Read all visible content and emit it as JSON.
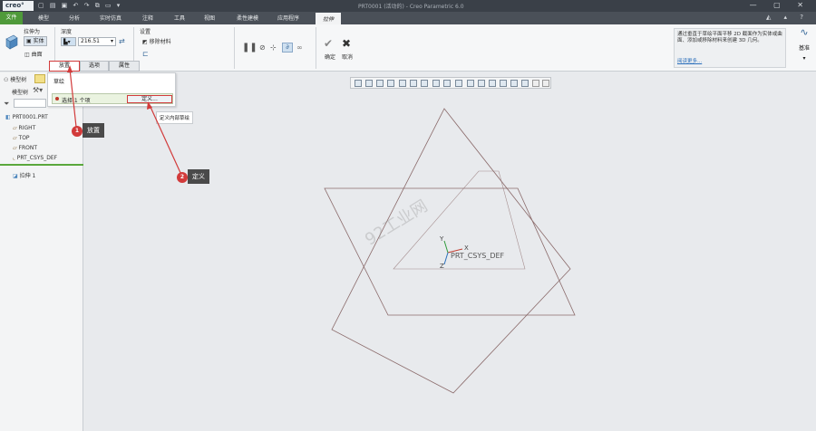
{
  "titlebar": {
    "logo": "creo°",
    "title": "PRT0001 (活动的) - Creo Parametric 6.0",
    "qat_icons": "▢ ▤ ▣ ↶ ↷ ⧉ ▭ ▾",
    "win_controls": "— ▢ ✕"
  },
  "menu": {
    "file": "文件",
    "items": [
      "模型",
      "分析",
      "实时仿真",
      "注释",
      "工具",
      "视图",
      "柔性建模",
      "应用程序"
    ],
    "active": "拉伸",
    "right_icons": "◭ ▴ ?"
  },
  "ribbon": {
    "extrude_as_label": "拉伸为",
    "solid_label": "实体",
    "surface_label": "曲面",
    "depth_label": "深度",
    "depth_value": "216.51",
    "settings_label": "设置",
    "remove_material_label": "移除材料",
    "ok_label": "确定",
    "cancel_label": "取消",
    "help_text": "通过垂直于草绘平面平移 2D 截面作为实体或曲面、添加或移除材料来创建 3D 几何。",
    "help_more": "阅读更多...",
    "base_label": "基准"
  },
  "tabs": [
    "放置",
    "选项",
    "属性"
  ],
  "placement_panel": {
    "sketch_label": "草绘",
    "selection_text": "选择 1 个项",
    "define_button": "定义..."
  },
  "tooltip": "定义内部草绘",
  "left_pane": {
    "tab_model_tree": "模型树",
    "model_tree_menu": "模型树",
    "root": "PRT0001.PRT",
    "items": [
      "RIGHT",
      "TOP",
      "FRONT",
      "PRT_CSYS_DEF"
    ],
    "feature": "拉伸 1"
  },
  "canvas": {
    "csys_label": "PRT_CSYS_DEF",
    "axis_x": "X",
    "axis_y": "Y",
    "axis_z": "Z",
    "watermark": "92工业网"
  },
  "callouts": [
    {
      "number": "1",
      "label": "放置"
    },
    {
      "number": "2",
      "label": "定义"
    }
  ],
  "colors": {
    "accent_red": "#d23b3b",
    "file_green": "#4f9a3a"
  }
}
